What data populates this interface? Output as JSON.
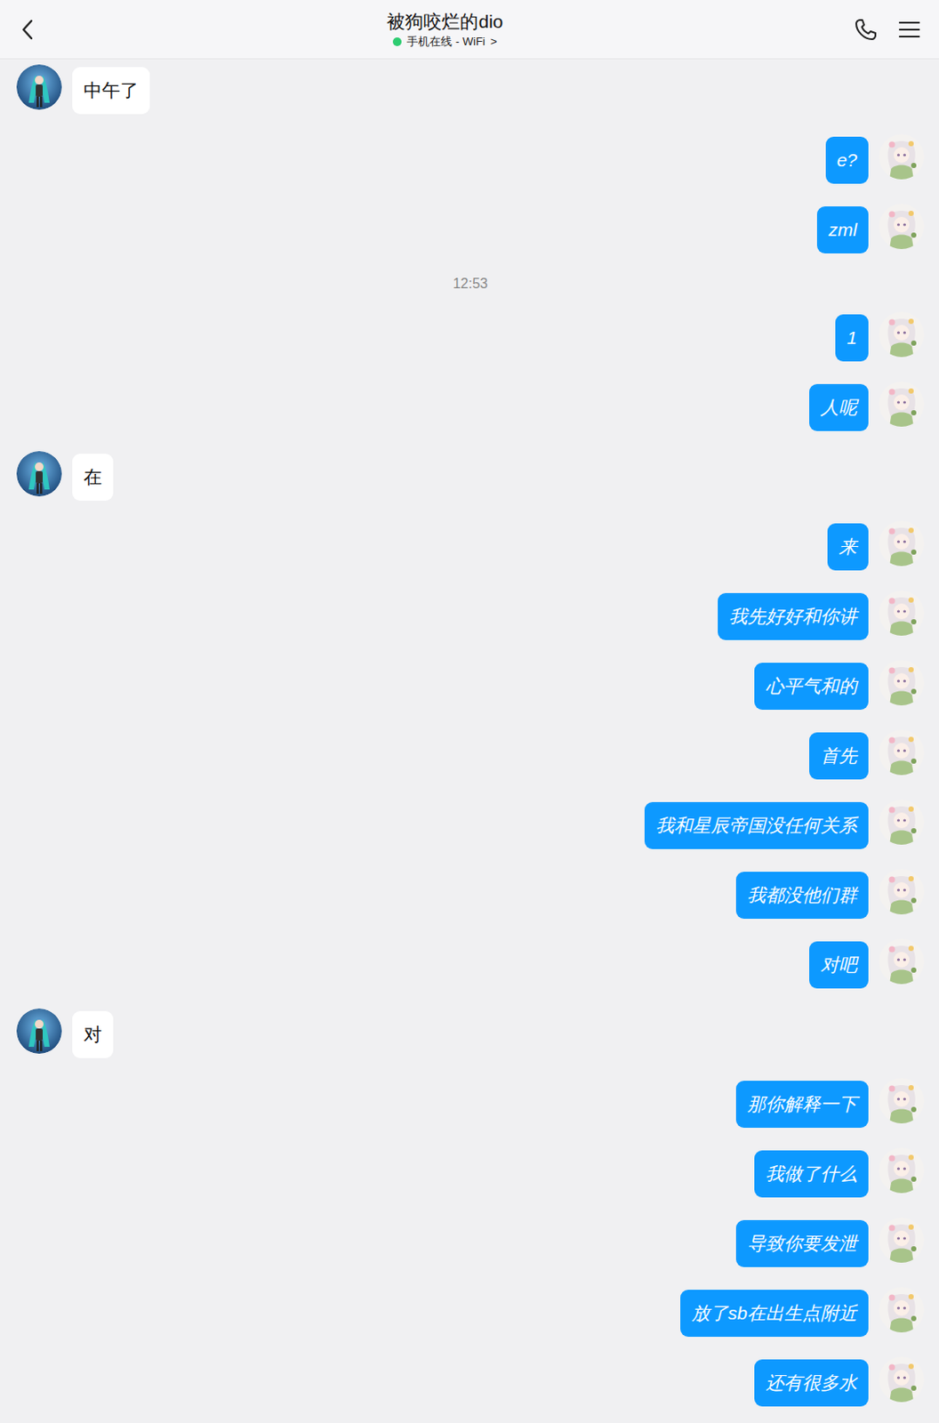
{
  "header": {
    "title": "被狗咬烂的dio",
    "status": "手机在线 - WiFi",
    "status_arrow": ">",
    "online": true
  },
  "messages": [
    {
      "kind": "received",
      "text": "中午了"
    },
    {
      "kind": "sent",
      "text": "e?"
    },
    {
      "kind": "sent",
      "text": "zml"
    },
    {
      "kind": "time",
      "text": "12:53"
    },
    {
      "kind": "sent",
      "text": "1"
    },
    {
      "kind": "sent",
      "text": "人呢"
    },
    {
      "kind": "received",
      "text": "在"
    },
    {
      "kind": "sent",
      "text": "来"
    },
    {
      "kind": "sent",
      "text": "我先好好和你讲"
    },
    {
      "kind": "sent",
      "text": "心平气和的"
    },
    {
      "kind": "sent",
      "text": "首先"
    },
    {
      "kind": "sent",
      "text": "我和星辰帝国没任何关系"
    },
    {
      "kind": "sent",
      "text": "我都没他们群"
    },
    {
      "kind": "sent",
      "text": "对吧"
    },
    {
      "kind": "received",
      "text": "对"
    },
    {
      "kind": "sent",
      "text": "那你解释一下"
    },
    {
      "kind": "sent",
      "text": "我做了什么"
    },
    {
      "kind": "sent",
      "text": "导致你要发泄"
    },
    {
      "kind": "sent",
      "text": "放了sb在出生点附近"
    },
    {
      "kind": "sent",
      "text": "还有很多水"
    }
  ]
}
